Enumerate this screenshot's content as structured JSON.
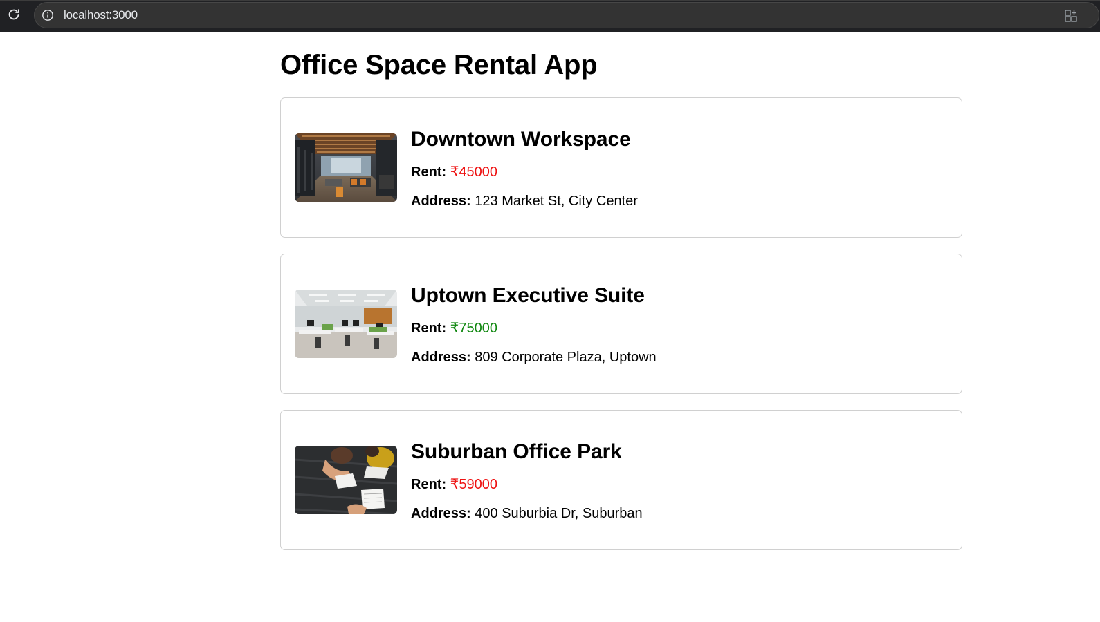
{
  "browser": {
    "url": "localhost:3000"
  },
  "app": {
    "title": "Office Space Rental App"
  },
  "labels": {
    "rent": "Rent:",
    "address": "Address:"
  },
  "offices": [
    {
      "name": "Downtown Workspace",
      "rent": "₹45000",
      "rent_color": "#ee1111",
      "address": "123 Market St, City Center",
      "image": "open-office-interior"
    },
    {
      "name": "Uptown Executive Suite",
      "rent": "₹75000",
      "rent_color": "#118811",
      "address": "809 Corporate Plaza, Uptown",
      "image": "bright-open-office"
    },
    {
      "name": "Suburban Office Park",
      "rent": "₹59000",
      "rent_color": "#ee1111",
      "address": "400 Suburbia Dr, Suburban",
      "image": "people-reading-at-table"
    }
  ]
}
